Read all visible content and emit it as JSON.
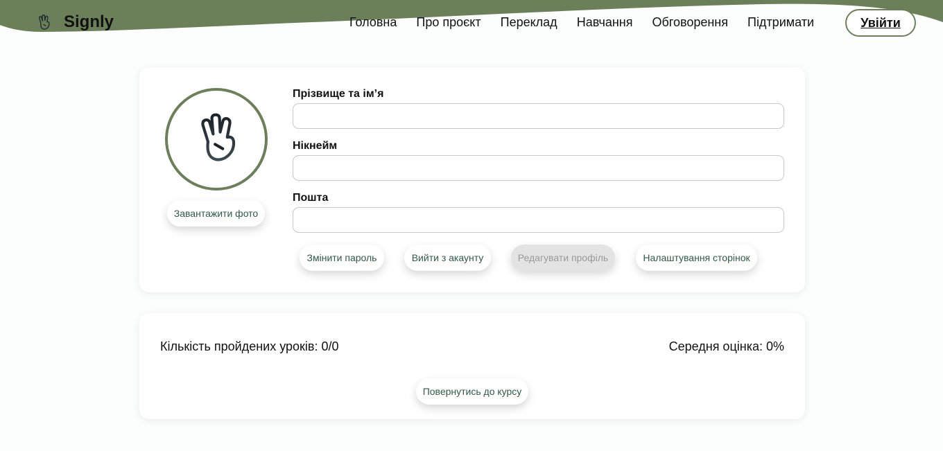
{
  "header": {
    "brand": "Signly",
    "nav": [
      "Головна",
      "Про проєкт",
      "Переклад",
      "Навчання",
      "Обговорення",
      "Підтримати"
    ],
    "login_label": "Увійти"
  },
  "profile": {
    "upload_photo_label": "Завантажити фото",
    "fields": {
      "full_name": {
        "label": "Прізвище та ім’я",
        "value": "",
        "placeholder": ""
      },
      "nickname": {
        "label": "Нікнейм",
        "value": "",
        "placeholder": ""
      },
      "email": {
        "label": "Пошта",
        "value": "",
        "placeholder": ""
      }
    },
    "actions": {
      "change_password": "Змінити пароль",
      "logout": "Вийти з акаунту",
      "edit_profile": "Редагувати профіль",
      "page_settings": "Налаштування сторінок"
    }
  },
  "stats": {
    "lessons_completed_label": "Кількість пройдених уроків: 0/0",
    "average_score_label": "Середня оцінка: 0%",
    "return_label": "Повернутись до курсу"
  },
  "colors": {
    "accent": "#6b8058",
    "pill_text": "#2f5a45",
    "disabled_bg": "#e3e3e3"
  },
  "icons": {
    "logo": "hand-sign-icon",
    "avatar": "hand-sign-icon"
  }
}
